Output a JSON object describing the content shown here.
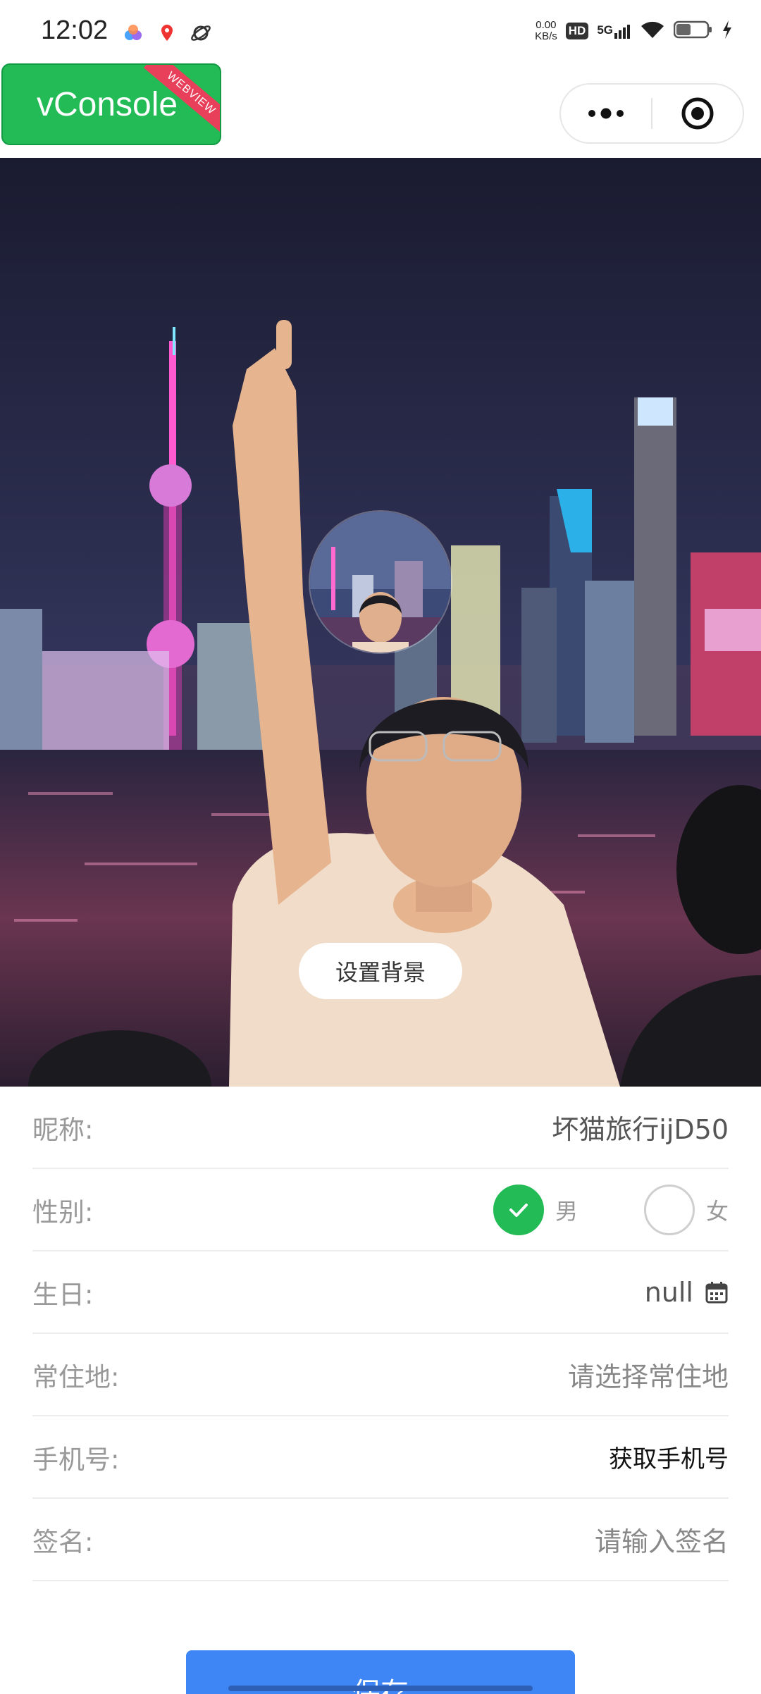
{
  "status_bar": {
    "time": "12:02",
    "net_speed_value": "0.00",
    "net_speed_unit": "KB/s",
    "hd": "HD",
    "signal": "5G",
    "icons": [
      "cloud-app-icon",
      "map-pin-app-icon",
      "planet-app-icon",
      "wifi-icon",
      "battery-icon",
      "charging-icon"
    ]
  },
  "vconsole": {
    "label": "vConsole",
    "ribbon": "WEBVIEW"
  },
  "capsule": {
    "icons": [
      "more-icon",
      "close-target-icon"
    ]
  },
  "header": {
    "set_background_label": "设置背景"
  },
  "form": {
    "nickname": {
      "label": "昵称:",
      "value": "坏猫旅行ijD50"
    },
    "gender": {
      "label": "性别:",
      "options": [
        "男",
        "女"
      ],
      "selected": "男"
    },
    "birthday": {
      "label": "生日:",
      "value": "null",
      "icon": "calendar-icon"
    },
    "residence": {
      "label": "常住地:",
      "placeholder": "请选择常住地"
    },
    "phone": {
      "label": "手机号:",
      "action": "获取手机号"
    },
    "signature": {
      "label": "签名:",
      "placeholder": "请输入签名"
    }
  },
  "save_label": "保存",
  "colors": {
    "accent_green": "#22bb55",
    "button_blue": "#3e85f5",
    "ribbon_red": "#e8405a"
  }
}
